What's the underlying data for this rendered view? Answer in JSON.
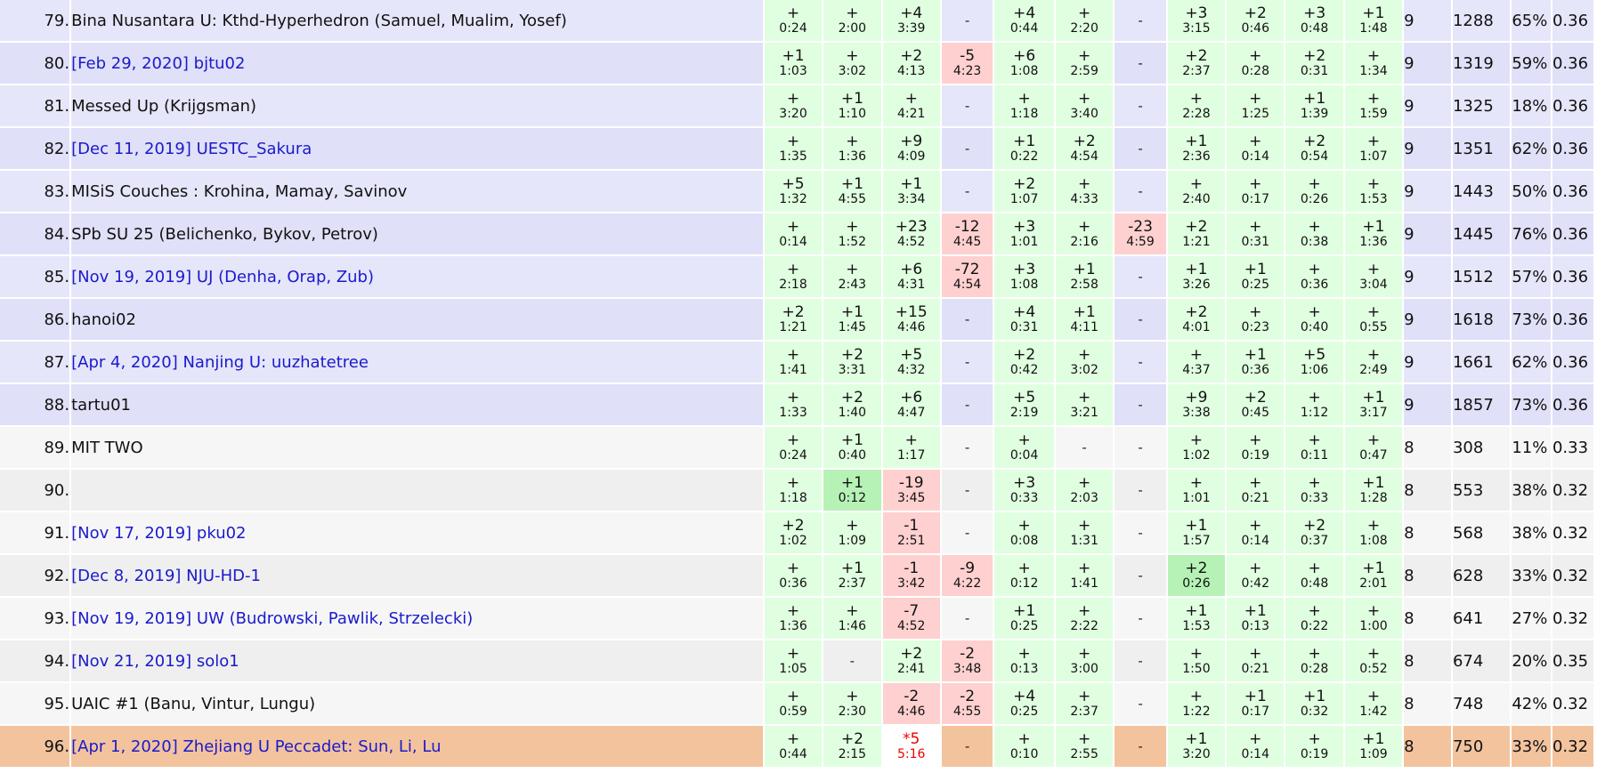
{
  "colors": {
    "accepted": "#e0ffe0",
    "first_to_solve": "#b6f2b6",
    "rejected": "#ffd0d0",
    "row_9_solved": "#e6e6fa",
    "row_8_solved": "#f6f6f6",
    "highlight_row": "#f3c39e",
    "link_text": "#1a1acc",
    "pending_text": "#ee0000"
  },
  "rows": [
    {
      "rank": "79.",
      "team": "Bina Nusantara U: Kthd-Hyperhedron (Samuel, Mualim, Yosef)",
      "link": false,
      "band": 9,
      "alt": false,
      "highlight": false,
      "cells": [
        [
          "ok",
          "+",
          "0:24"
        ],
        [
          "ok",
          "+",
          "2:00"
        ],
        [
          "ok",
          "+4",
          "3:39"
        ],
        [
          "empty",
          "-",
          ""
        ],
        [
          "ok",
          "+4",
          "0:44"
        ],
        [
          "ok",
          "+",
          "2:20"
        ],
        [
          "empty",
          "-",
          ""
        ],
        [
          "ok",
          "+3",
          "3:15"
        ],
        [
          "ok",
          "+2",
          "0:46"
        ],
        [
          "ok",
          "+3",
          "0:48"
        ],
        [
          "ok",
          "+1",
          "1:48"
        ]
      ],
      "solved": "9",
      "penalty": "1288",
      "pct": "65%",
      "rating": "0.36"
    },
    {
      "rank": "80.",
      "team": "[Feb 29, 2020] bjtu02",
      "link": true,
      "band": 9,
      "alt": true,
      "highlight": false,
      "cells": [
        [
          "ok",
          "+1",
          "1:03"
        ],
        [
          "ok",
          "+",
          "3:02"
        ],
        [
          "ok",
          "+2",
          "4:13"
        ],
        [
          "bad",
          "-5",
          "4:23"
        ],
        [
          "ok",
          "+6",
          "1:08"
        ],
        [
          "ok",
          "+",
          "2:59"
        ],
        [
          "empty",
          "-",
          ""
        ],
        [
          "ok",
          "+2",
          "2:37"
        ],
        [
          "ok",
          "+",
          "0:28"
        ],
        [
          "ok",
          "+2",
          "0:31"
        ],
        [
          "ok",
          "+",
          "1:34"
        ]
      ],
      "solved": "9",
      "penalty": "1319",
      "pct": "59%",
      "rating": "0.36"
    },
    {
      "rank": "81.",
      "team": "Messed Up (Krijgsman)",
      "link": false,
      "band": 9,
      "alt": false,
      "highlight": false,
      "cells": [
        [
          "ok",
          "+",
          "3:20"
        ],
        [
          "ok",
          "+1",
          "1:10"
        ],
        [
          "ok",
          "+",
          "4:21"
        ],
        [
          "empty",
          "-",
          ""
        ],
        [
          "ok",
          "+",
          "1:18"
        ],
        [
          "ok",
          "+",
          "3:40"
        ],
        [
          "empty",
          "-",
          ""
        ],
        [
          "ok",
          "+",
          "2:28"
        ],
        [
          "ok",
          "+",
          "1:25"
        ],
        [
          "ok",
          "+1",
          "1:39"
        ],
        [
          "ok",
          "+",
          "1:59"
        ]
      ],
      "solved": "9",
      "penalty": "1325",
      "pct": "18%",
      "rating": "0.36"
    },
    {
      "rank": "82.",
      "team": "[Dec 11, 2019] UESTC_Sakura",
      "link": true,
      "band": 9,
      "alt": true,
      "highlight": false,
      "cells": [
        [
          "ok",
          "+",
          "1:35"
        ],
        [
          "ok",
          "+",
          "1:36"
        ],
        [
          "ok",
          "+9",
          "4:09"
        ],
        [
          "empty",
          "-",
          ""
        ],
        [
          "ok",
          "+1",
          "0:22"
        ],
        [
          "ok",
          "+2",
          "4:54"
        ],
        [
          "empty",
          "-",
          ""
        ],
        [
          "ok",
          "+1",
          "2:36"
        ],
        [
          "ok",
          "+",
          "0:14"
        ],
        [
          "ok",
          "+2",
          "0:54"
        ],
        [
          "ok",
          "+",
          "1:07"
        ]
      ],
      "solved": "9",
      "penalty": "1351",
      "pct": "62%",
      "rating": "0.36"
    },
    {
      "rank": "83.",
      "team": "MISiS Couches : Krohina, Mamay, Savinov",
      "link": false,
      "band": 9,
      "alt": false,
      "highlight": false,
      "cells": [
        [
          "ok",
          "+5",
          "1:32"
        ],
        [
          "ok",
          "+1",
          "4:55"
        ],
        [
          "ok",
          "+1",
          "3:34"
        ],
        [
          "empty",
          "-",
          ""
        ],
        [
          "ok",
          "+2",
          "1:07"
        ],
        [
          "ok",
          "+",
          "4:33"
        ],
        [
          "empty",
          "-",
          ""
        ],
        [
          "ok",
          "+",
          "2:40"
        ],
        [
          "ok",
          "+",
          "0:17"
        ],
        [
          "ok",
          "+",
          "0:26"
        ],
        [
          "ok",
          "+",
          "1:53"
        ]
      ],
      "solved": "9",
      "penalty": "1443",
      "pct": "50%",
      "rating": "0.36"
    },
    {
      "rank": "84.",
      "team": "SPb SU 25 (Belichenko, Bykov, Petrov)",
      "link": false,
      "band": 9,
      "alt": true,
      "highlight": false,
      "cells": [
        [
          "ok",
          "+",
          "0:14"
        ],
        [
          "ok",
          "+",
          "1:52"
        ],
        [
          "ok",
          "+23",
          "4:52"
        ],
        [
          "bad",
          "-12",
          "4:45"
        ],
        [
          "ok",
          "+3",
          "1:01"
        ],
        [
          "ok",
          "+",
          "2:16"
        ],
        [
          "bad",
          "-23",
          "4:59"
        ],
        [
          "ok",
          "+2",
          "1:21"
        ],
        [
          "ok",
          "+",
          "0:31"
        ],
        [
          "ok",
          "+",
          "0:38"
        ],
        [
          "ok",
          "+1",
          "1:36"
        ]
      ],
      "solved": "9",
      "penalty": "1445",
      "pct": "76%",
      "rating": "0.36"
    },
    {
      "rank": "85.",
      "team": "[Nov 19, 2019] UJ (Denha, Orap, Zub)",
      "link": true,
      "band": 9,
      "alt": false,
      "highlight": false,
      "cells": [
        [
          "ok",
          "+",
          "2:18"
        ],
        [
          "ok",
          "+",
          "2:43"
        ],
        [
          "ok",
          "+6",
          "4:31"
        ],
        [
          "bad",
          "-72",
          "4:54"
        ],
        [
          "ok",
          "+3",
          "1:08"
        ],
        [
          "ok",
          "+1",
          "2:58"
        ],
        [
          "empty",
          "-",
          ""
        ],
        [
          "ok",
          "+1",
          "3:26"
        ],
        [
          "ok",
          "+1",
          "0:25"
        ],
        [
          "ok",
          "+",
          "0:36"
        ],
        [
          "ok",
          "+",
          "3:04"
        ]
      ],
      "solved": "9",
      "penalty": "1512",
      "pct": "57%",
      "rating": "0.36"
    },
    {
      "rank": "86.",
      "team": "hanoi02",
      "link": false,
      "band": 9,
      "alt": true,
      "highlight": false,
      "cells": [
        [
          "ok",
          "+2",
          "1:21"
        ],
        [
          "ok",
          "+1",
          "1:45"
        ],
        [
          "ok",
          "+15",
          "4:46"
        ],
        [
          "empty",
          "-",
          ""
        ],
        [
          "ok",
          "+4",
          "0:31"
        ],
        [
          "ok",
          "+1",
          "4:11"
        ],
        [
          "empty",
          "-",
          ""
        ],
        [
          "ok",
          "+2",
          "4:01"
        ],
        [
          "ok",
          "+",
          "0:23"
        ],
        [
          "ok",
          "+",
          "0:40"
        ],
        [
          "ok",
          "+",
          "0:55"
        ]
      ],
      "solved": "9",
      "penalty": "1618",
      "pct": "73%",
      "rating": "0.36"
    },
    {
      "rank": "87.",
      "team": "[Apr 4, 2020] Nanjing U: uuzhatetree",
      "link": true,
      "band": 9,
      "alt": false,
      "highlight": false,
      "cells": [
        [
          "ok",
          "+",
          "1:41"
        ],
        [
          "ok",
          "+2",
          "3:31"
        ],
        [
          "ok",
          "+5",
          "4:32"
        ],
        [
          "empty",
          "-",
          ""
        ],
        [
          "ok",
          "+2",
          "0:42"
        ],
        [
          "ok",
          "+",
          "3:02"
        ],
        [
          "empty",
          "-",
          ""
        ],
        [
          "ok",
          "+",
          "4:37"
        ],
        [
          "ok",
          "+1",
          "0:36"
        ],
        [
          "ok",
          "+5",
          "1:06"
        ],
        [
          "ok",
          "+",
          "2:49"
        ]
      ],
      "solved": "9",
      "penalty": "1661",
      "pct": "62%",
      "rating": "0.36"
    },
    {
      "rank": "88.",
      "team": "tartu01",
      "link": false,
      "band": 9,
      "alt": true,
      "highlight": false,
      "cells": [
        [
          "ok",
          "+",
          "1:33"
        ],
        [
          "ok",
          "+2",
          "1:40"
        ],
        [
          "ok",
          "+6",
          "4:47"
        ],
        [
          "empty",
          "-",
          ""
        ],
        [
          "ok",
          "+5",
          "2:19"
        ],
        [
          "ok",
          "+",
          "3:21"
        ],
        [
          "empty",
          "-",
          ""
        ],
        [
          "ok",
          "+9",
          "3:38"
        ],
        [
          "ok",
          "+2",
          "0:45"
        ],
        [
          "ok",
          "+",
          "1:12"
        ],
        [
          "ok",
          "+1",
          "3:17"
        ]
      ],
      "solved": "9",
      "penalty": "1857",
      "pct": "73%",
      "rating": "0.36"
    },
    {
      "rank": "89.",
      "team": "MIT TWO",
      "link": false,
      "band": 8,
      "alt": false,
      "highlight": false,
      "cells": [
        [
          "ok",
          "+",
          "0:24"
        ],
        [
          "ok",
          "+1",
          "0:40"
        ],
        [
          "ok",
          "+",
          "1:17"
        ],
        [
          "empty",
          "-",
          ""
        ],
        [
          "ok",
          "+",
          "0:04"
        ],
        [
          "empty",
          "-",
          ""
        ],
        [
          "empty",
          "-",
          ""
        ],
        [
          "ok",
          "+",
          "1:02"
        ],
        [
          "ok",
          "+",
          "0:19"
        ],
        [
          "ok",
          "+",
          "0:11"
        ],
        [
          "ok",
          "+",
          "0:47"
        ]
      ],
      "solved": "8",
      "penalty": "308",
      "pct": "11%",
      "rating": "0.33"
    },
    {
      "rank": "90.",
      "team": "",
      "link": false,
      "band": 8,
      "alt": true,
      "highlight": false,
      "cells": [
        [
          "ok",
          "+",
          "1:18"
        ],
        [
          "ok1",
          "+1",
          "0:12"
        ],
        [
          "bad",
          "-19",
          "3:45"
        ],
        [
          "empty",
          "-",
          ""
        ],
        [
          "ok",
          "+3",
          "0:33"
        ],
        [
          "ok",
          "+",
          "2:03"
        ],
        [
          "empty",
          "-",
          ""
        ],
        [
          "ok",
          "+",
          "1:01"
        ],
        [
          "ok",
          "+",
          "0:21"
        ],
        [
          "ok",
          "+",
          "0:33"
        ],
        [
          "ok",
          "+1",
          "1:28"
        ]
      ],
      "solved": "8",
      "penalty": "553",
      "pct": "38%",
      "rating": "0.32"
    },
    {
      "rank": "91.",
      "team": "[Nov 17, 2019] pku02",
      "link": true,
      "band": 8,
      "alt": false,
      "highlight": false,
      "cells": [
        [
          "ok",
          "+2",
          "1:02"
        ],
        [
          "ok",
          "+",
          "1:09"
        ],
        [
          "bad",
          "-1",
          "2:51"
        ],
        [
          "empty",
          "-",
          ""
        ],
        [
          "ok",
          "+",
          "0:08"
        ],
        [
          "ok",
          "+",
          "1:31"
        ],
        [
          "empty",
          "-",
          ""
        ],
        [
          "ok",
          "+1",
          "1:57"
        ],
        [
          "ok",
          "+",
          "0:14"
        ],
        [
          "ok",
          "+2",
          "0:37"
        ],
        [
          "ok",
          "+",
          "1:08"
        ]
      ],
      "solved": "8",
      "penalty": "568",
      "pct": "38%",
      "rating": "0.32"
    },
    {
      "rank": "92.",
      "team": "[Dec 8, 2019] NJU-HD-1",
      "link": true,
      "band": 8,
      "alt": true,
      "highlight": false,
      "cells": [
        [
          "ok",
          "+",
          "0:36"
        ],
        [
          "ok",
          "+1",
          "2:37"
        ],
        [
          "bad",
          "-1",
          "3:42"
        ],
        [
          "bad",
          "-9",
          "4:22"
        ],
        [
          "ok",
          "+",
          "0:12"
        ],
        [
          "ok",
          "+",
          "1:41"
        ],
        [
          "empty",
          "-",
          ""
        ],
        [
          "ok1",
          "+2",
          "0:26"
        ],
        [
          "ok",
          "+",
          "0:42"
        ],
        [
          "ok",
          "+",
          "0:48"
        ],
        [
          "ok",
          "+1",
          "2:01"
        ]
      ],
      "solved": "8",
      "penalty": "628",
      "pct": "33%",
      "rating": "0.32"
    },
    {
      "rank": "93.",
      "team": "[Nov 19, 2019] UW (Budrowski, Pawlik, Strzelecki)",
      "link": true,
      "band": 8,
      "alt": false,
      "highlight": false,
      "cells": [
        [
          "ok",
          "+",
          "1:36"
        ],
        [
          "ok",
          "+",
          "1:46"
        ],
        [
          "bad",
          "-7",
          "4:52"
        ],
        [
          "empty",
          "-",
          ""
        ],
        [
          "ok",
          "+1",
          "0:25"
        ],
        [
          "ok",
          "+",
          "2:22"
        ],
        [
          "empty",
          "-",
          ""
        ],
        [
          "ok",
          "+1",
          "1:53"
        ],
        [
          "ok",
          "+1",
          "0:13"
        ],
        [
          "ok",
          "+",
          "0:22"
        ],
        [
          "ok",
          "+",
          "1:00"
        ]
      ],
      "solved": "8",
      "penalty": "641",
      "pct": "27%",
      "rating": "0.32"
    },
    {
      "rank": "94.",
      "team": "[Nov 21, 2019] solo1",
      "link": true,
      "band": 8,
      "alt": true,
      "highlight": false,
      "cells": [
        [
          "ok",
          "+",
          "1:05"
        ],
        [
          "empty",
          "-",
          ""
        ],
        [
          "ok",
          "+2",
          "2:41"
        ],
        [
          "bad",
          "-2",
          "3:48"
        ],
        [
          "ok",
          "+",
          "0:13"
        ],
        [
          "ok",
          "+",
          "3:00"
        ],
        [
          "empty",
          "-",
          ""
        ],
        [
          "ok",
          "+",
          "1:50"
        ],
        [
          "ok",
          "+",
          "0:21"
        ],
        [
          "ok",
          "+",
          "0:28"
        ],
        [
          "ok",
          "+",
          "0:52"
        ]
      ],
      "solved": "8",
      "penalty": "674",
      "pct": "20%",
      "rating": "0.35"
    },
    {
      "rank": "95.",
      "team": "UAIC #1 (Banu, Vintur, Lungu)",
      "link": false,
      "band": 8,
      "alt": false,
      "highlight": false,
      "cells": [
        [
          "ok",
          "+",
          "0:59"
        ],
        [
          "ok",
          "+",
          "2:30"
        ],
        [
          "bad",
          "-2",
          "4:46"
        ],
        [
          "bad",
          "-2",
          "4:55"
        ],
        [
          "ok",
          "+4",
          "0:25"
        ],
        [
          "ok",
          "+",
          "2:37"
        ],
        [
          "empty",
          "-",
          ""
        ],
        [
          "ok",
          "+",
          "1:22"
        ],
        [
          "ok",
          "+1",
          "0:17"
        ],
        [
          "ok",
          "+1",
          "0:32"
        ],
        [
          "ok",
          "+",
          "1:42"
        ]
      ],
      "solved": "8",
      "penalty": "748",
      "pct": "42%",
      "rating": "0.32"
    },
    {
      "rank": "96.",
      "team": "[Apr 1, 2020] Zhejiang U Peccadet: Sun, Li, Lu",
      "link": true,
      "band": 8,
      "alt": false,
      "highlight": true,
      "cells": [
        [
          "ok",
          "+",
          "0:44"
        ],
        [
          "ok",
          "+2",
          "2:15"
        ],
        [
          "pend",
          "*5",
          "5:16"
        ],
        [
          "empty",
          "-",
          ""
        ],
        [
          "ok",
          "+",
          "0:10"
        ],
        [
          "ok",
          "+",
          "2:55"
        ],
        [
          "empty",
          "-",
          ""
        ],
        [
          "ok",
          "+1",
          "3:20"
        ],
        [
          "ok",
          "+",
          "0:14"
        ],
        [
          "ok",
          "+",
          "0:19"
        ],
        [
          "ok",
          "+1",
          "1:09"
        ]
      ],
      "solved": "8",
      "penalty": "750",
      "pct": "33%",
      "rating": "0.32"
    }
  ]
}
